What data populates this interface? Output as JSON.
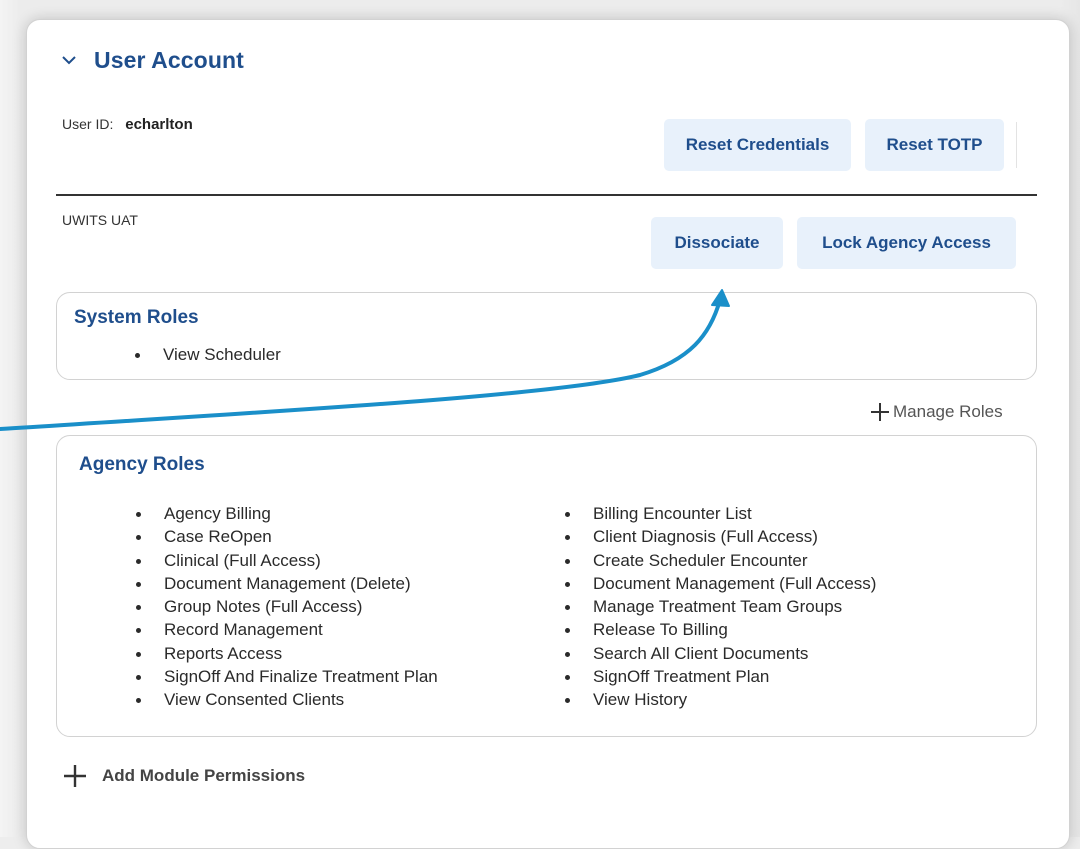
{
  "section": {
    "title": "User Account"
  },
  "user": {
    "id_label": "User ID:",
    "id_value": "echarlton"
  },
  "buttons": {
    "reset_credentials": "Reset Credentials",
    "reset_totp": "Reset TOTP",
    "dissociate": "Dissociate",
    "lock_agency_access": "Lock Agency Access"
  },
  "agency": {
    "name": "UWITS UAT"
  },
  "system_roles": {
    "title": "System Roles",
    "items": [
      "View Scheduler"
    ]
  },
  "manage_roles": {
    "label": "Manage Roles"
  },
  "agency_roles": {
    "title": "Agency Roles",
    "column1": [
      "Agency Billing",
      "Case ReOpen",
      "Clinical (Full Access)",
      "Document Management (Delete)",
      "Group Notes (Full Access)",
      "Record Management",
      "Reports Access",
      "SignOff And Finalize Treatment Plan",
      "View Consented Clients"
    ],
    "column2": [
      "Billing Encounter List",
      "Client Diagnosis (Full Access)",
      "Create Scheduler Encounter",
      "Document Management (Full Access)",
      "Manage Treatment Team Groups",
      "Release To Billing",
      "Search All Client Documents",
      "SignOff Treatment Plan",
      "View History"
    ]
  },
  "add_module": {
    "label": "Add Module Permissions"
  },
  "icons": {
    "collapse": "chevron-down-icon",
    "manage_roles": "plus-icon",
    "add_module": "plus-icon"
  },
  "colors": {
    "accent": "#1f4e8c",
    "button_bg": "#e8f1fb",
    "annotation_arrow": "#1a8fc9"
  }
}
